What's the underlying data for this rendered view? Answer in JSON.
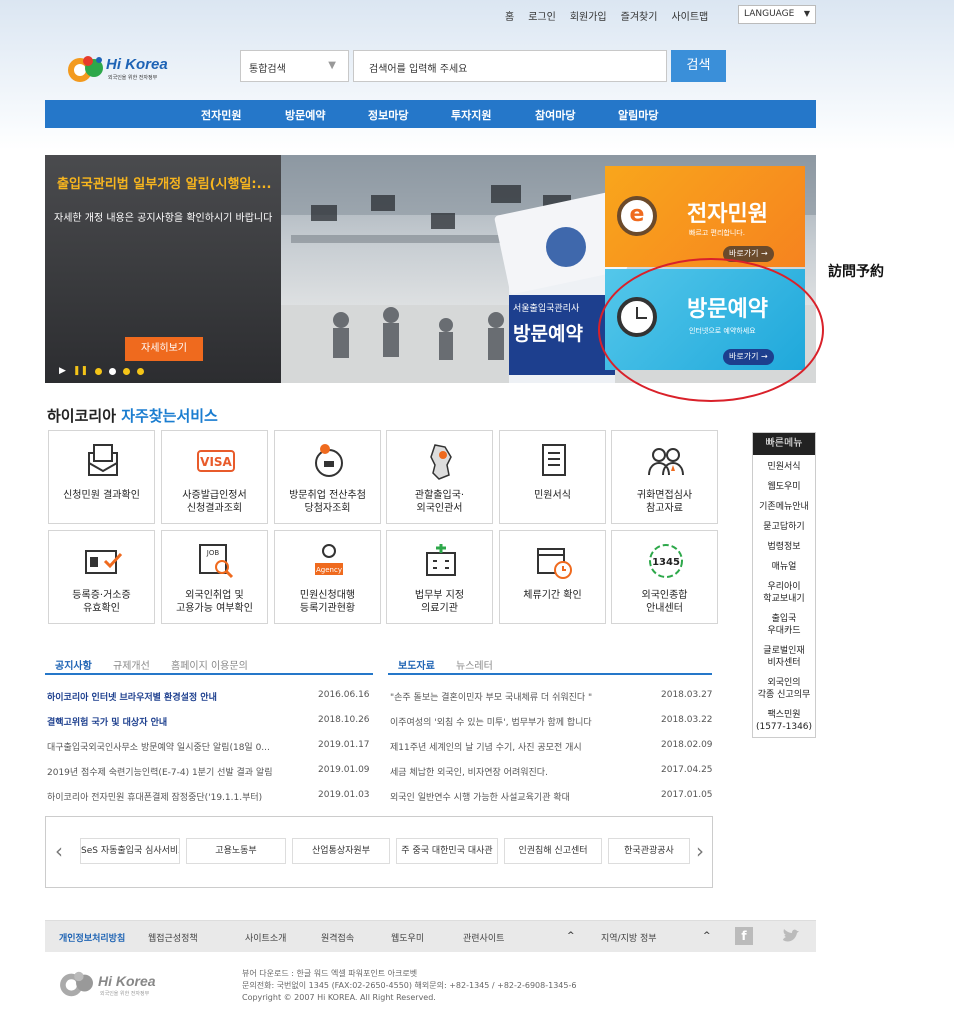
{
  "top_nav": [
    "홈",
    "로그인",
    "회원가입",
    "즐겨찾기",
    "사이트맵"
  ],
  "language": "LANGUAGE",
  "logo": {
    "name": "Hi Korea",
    "sub": "외국인을 위한 전자정부"
  },
  "search": {
    "scope": "통합검색",
    "placeholder": "검색어를 입력해 주세요",
    "button": "검색"
  },
  "gnb": [
    "전자민원",
    "방문예약",
    "정보마당",
    "투자지원",
    "참여마당",
    "알림마당"
  ],
  "hero": {
    "title": "출입국관리법 일부개정 알림(시행일:...",
    "desc": "자세한 개정 내용은 공지사항을 확인하시기 바랍니다",
    "more": "자세히보기",
    "sign_top": "서울출입국관리사",
    "sign_big": "방문예약",
    "box1": {
      "title": "전자민원",
      "sub": "빠르고 편리합니다.",
      "go": "바로가기 →"
    },
    "box2": {
      "title": "방문예약",
      "sub": "인터넷으로 예약하세요",
      "go": "바로가기 →"
    }
  },
  "annotation": "訪問予約",
  "section": {
    "prefix": "하이코리아",
    "highlight": "자주찾는서비스"
  },
  "services": [
    {
      "label": "신청민원 결과확인",
      "icon": "envelope-doc-icon"
    },
    {
      "label": "사증발급인정서\n신청결과조회",
      "icon": "visa-stamp-icon"
    },
    {
      "label": "방문취업 전산추첨\n당첨자조회",
      "icon": "lottery-ball-icon"
    },
    {
      "label": "관할출입국·\n외국인관서",
      "icon": "korea-map-icon"
    },
    {
      "label": "민원서식",
      "icon": "form-doc-icon"
    },
    {
      "label": "귀화면접심사\n참고자료",
      "icon": "people-icon"
    },
    {
      "label": "등록증·거소증\n유효확인",
      "icon": "id-card-check-icon"
    },
    {
      "label": "외국인취업 및\n고용가능 여부확인",
      "icon": "job-search-icon"
    },
    {
      "label": "민원신청대행\n등록기관현황",
      "icon": "agency-icon"
    },
    {
      "label": "법무부 지정\n의료기관",
      "icon": "hospital-icon"
    },
    {
      "label": "체류기간 확인",
      "icon": "calendar-clock-icon"
    },
    {
      "label": "외국인종합\n안내센터",
      "icon": "call-1345-icon"
    }
  ],
  "quick": {
    "title": "빠른메뉴",
    "items": [
      "민원서식",
      "웹도우미",
      "기존메뉴안내",
      "묻고답하기",
      "법령정보",
      "매뉴얼",
      "우리아이\n학교보내기",
      "출입국\n우대카드",
      "글로벌인재\n비자센터",
      "외국인의\n각종 신고의무",
      "팩스민원\n(1577-1346)"
    ]
  },
  "notice": {
    "tabs": [
      "공지사항",
      "규제개선",
      "홈페이지 이용문의"
    ],
    "rows": [
      {
        "title": "하이코리아 인터넷 브라우저별 환경설정 안내",
        "date": "2016.06.16",
        "bold": true
      },
      {
        "title": "결핵고위험 국가 및 대상자 안내",
        "date": "2018.10.26",
        "bold": true
      },
      {
        "title": "대구출입국외국인사무소 방문예약 일시중단 알림(18일 0...",
        "date": "2019.01.17",
        "bold": false
      },
      {
        "title": "2019년 점수제 숙련기능인력(E-7-4) 1분기 선발 결과 알림",
        "date": "2019.01.09",
        "bold": false
      },
      {
        "title": "하이코리아 전자민원 휴대폰결제 잠정중단('19.1.1.부터)",
        "date": "2019.01.03",
        "bold": false
      }
    ]
  },
  "press": {
    "tabs": [
      "보도자료",
      "뉴스레터"
    ],
    "rows": [
      {
        "title": "\"손주 돌보는 결혼이민자 부모 국내체류 더 쉬워진다 \"",
        "date": "2018.03.27"
      },
      {
        "title": "이주여성의 '외침 수 있는 미투', 법무부가 함께 합니다",
        "date": "2018.03.22"
      },
      {
        "title": "제11주년 세계인의 날 기념 수기, 사진 공모전 개시",
        "date": "2018.02.09"
      },
      {
        "title": "세금 체납한 외국인, 비자연장 어려워진다.",
        "date": "2017.04.25"
      },
      {
        "title": "외국인 일반연수 시행 가능한 사설교육기관 확대",
        "date": "2017.01.05"
      }
    ]
  },
  "banners": [
    "SeS 자동출입국 심사서비스신청",
    "고용노동부",
    "산업통상자원부",
    "주 중국 대한민국 대사관",
    "인권침해 신고센터",
    "한국관광공사"
  ],
  "footer": {
    "links": [
      "개인정보처리방침",
      "웹접근성정책",
      "사이트소개",
      "원격접속",
      "웹도우미",
      "관련사이트",
      "지역/지방 정부"
    ],
    "caret": "^",
    "viewer": "뷰어 다운로드 : 한글   워드   엑셀   파워포인트   아크로벳",
    "contact": "문의전화: 국번없이 1345 (FAX:02-2650-4550) 해외문의: +82-1345 / +82-2-6908-1345-6",
    "copyright": "Copyright © 2007 Hi KOREA. All Right Reserved."
  },
  "colors": {
    "brand_blue": "#2577c9",
    "accent_orange": "#ef6a1e",
    "highlight_yellow": "#f7b51e",
    "annotation_red": "#d9212a"
  }
}
